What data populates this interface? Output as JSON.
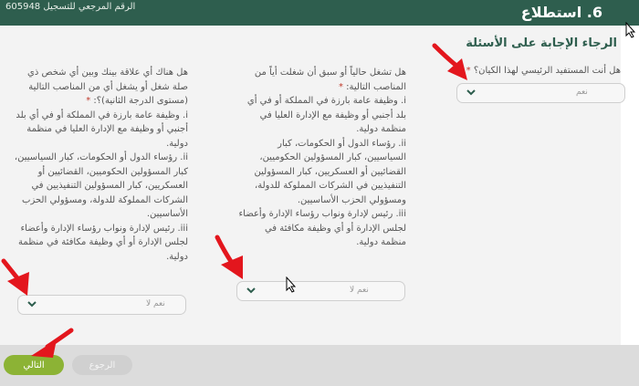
{
  "header": {
    "reference_label": "الرقم المرجعي للتسجيل 605948",
    "step_title": "6. استطلاع"
  },
  "page_title": "الرجاء الإجابة على الأسئلة",
  "questions": [
    {
      "question": "هل أنت المستفيد الرئيسي لهذا الكيان؟",
      "required_mark": "*",
      "items": [],
      "selected": "نعم"
    },
    {
      "question": "هل تشغل حالياً أو سبق أن شغلت أياً من المناصب التالية:",
      "required_mark": "*",
      "items": [
        "i. وظيفة عامة بارزة في المملكة أو في أي بلد أجنبي أو وظيفة مع الإدارة العليا في منظمة دولية.",
        "ii. رؤساء الدول أو الحكومات، كبار السياسيين، كبار المسؤولين الحكوميين، القضائيين أو العسكريين، كبار المسؤولين التنفيذيين في الشركات المملوكة للدولة، ومسؤولي الحزب الأساسيين.",
        "iii. رئيس لإدارة ونواب رؤساء الإدارة وأعضاء لجلس الإدارة أو أي وظيفة مكافئة في منظمة دولية."
      ],
      "selected": "نعم لا"
    },
    {
      "question": "هل هناك أي علاقة بينك وبين أي شخص ذي صلة شغل أو يشغل أي من المناصب التالية (مستوى الدرجة الثانية)؟:",
      "required_mark": "*",
      "items": [
        "i. وظيفة عامة بارزة في المملكة أو في أي بلد أجنبي أو وظيفة مع الإدارة العليا في منظمة دولية.",
        "ii. رؤساء الدول أو الحكومات، كبار السياسيين، كبار المسؤولين الحكوميين، القضائيين أو العسكريين، كبار المسؤولين التنفيذيين في الشركات المملوكة للدولة، ومسؤولي الحزب الأساسيين.",
        "iii. رئيس لإدارة ونواب رؤساء الإدارة وأعضاء لجلس الإدارة أو أي وظيفة مكافئة في منظمة دولية."
      ],
      "selected": "نعم لا"
    }
  ],
  "footer": {
    "next_label": "التالي",
    "back_label": "الرجوع"
  },
  "colors": {
    "header_bg": "#2e5e4e",
    "accent_green": "#8cb335",
    "annotation_red": "#e3161d",
    "title_green": "#2e5e4e"
  },
  "icons": [
    "chevron-down-icon",
    "annotation-arrow-icon",
    "mouse-cursor-icon"
  ]
}
